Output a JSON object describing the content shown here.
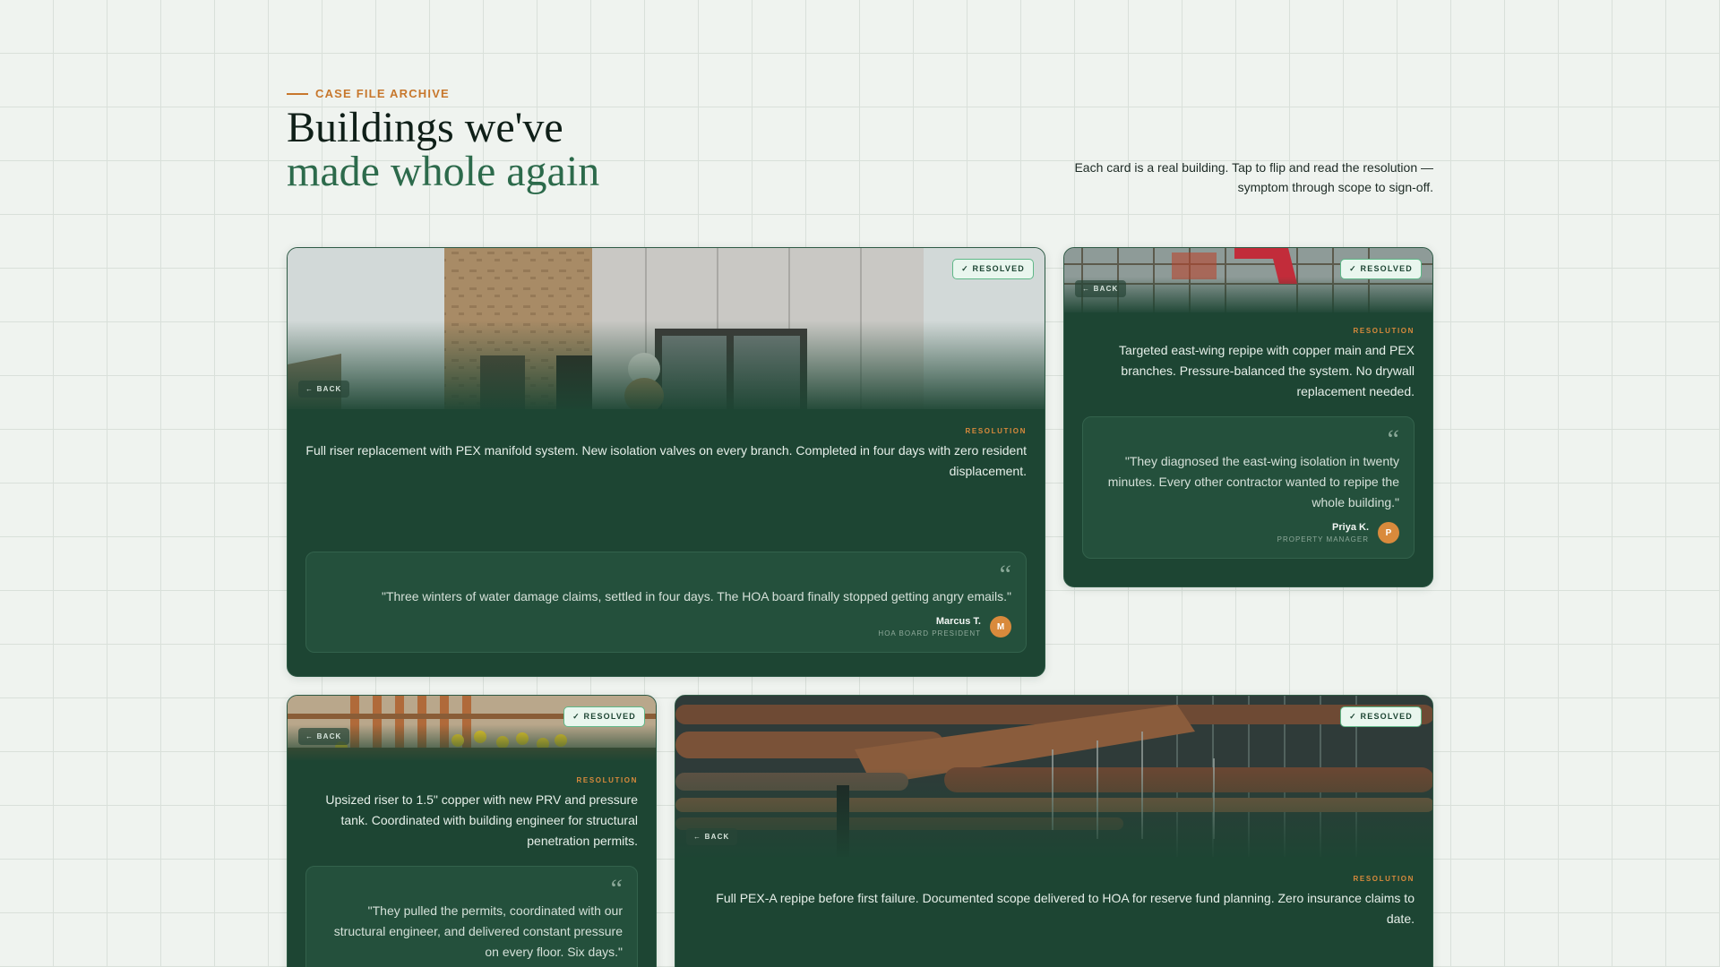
{
  "header": {
    "eyebrow": "CASE FILE ARCHIVE",
    "title_line1": "Buildings we've",
    "title_line2": "made whole again",
    "intro": "Each card is a real building. Tap to flip and read the resolution — symptom through scope to sign-off."
  },
  "colors": {
    "accent_orange": "#c7772c",
    "card_green": "#1d4533",
    "title_green": "#2c6a4b"
  },
  "cards": [
    {
      "badge": "✓ RESOLVED",
      "back": "← BACK",
      "resolution_label": "RESOLUTION",
      "resolution": "Full riser replacement with PEX manifold system. New isolation valves on every branch. Completed in four days with zero resident displacement.",
      "quote": "\"Three winters of water damage claims, settled in four days. The HOA board finally stopped getting angry emails.\"",
      "author_name": "Marcus T.",
      "author_role": "HOA BOARD PRESIDENT",
      "avatar": "M"
    },
    {
      "badge": "✓ RESOLVED",
      "back": "← BACK",
      "resolution_label": "RESOLUTION",
      "resolution": "Targeted east-wing repipe with copper main and PEX branches. Pressure-balanced the system. No drywall replacement needed.",
      "quote": "\"They diagnosed the east-wing isolation in twenty minutes. Every other contractor wanted to repipe the whole building.\"",
      "author_name": "Priya K.",
      "author_role": "PROPERTY MANAGER",
      "avatar": "P"
    },
    {
      "badge": "✓ RESOLVED",
      "back": "← BACK",
      "resolution_label": "RESOLUTION",
      "resolution": "Upsized riser to 1.5\" copper with new PRV and pressure tank. Coordinated with building engineer for structural penetration permits.",
      "quote": "\"They pulled the permits, coordinated with our structural engineer, and delivered constant pressure on every floor. Six days.\""
    },
    {
      "badge": "✓ RESOLVED",
      "back": "← BACK",
      "resolution_label": "RESOLUTION",
      "resolution": "Full PEX-A repipe before first failure. Documented scope delivered to HOA for reserve fund planning. Zero insurance claims to date."
    }
  ]
}
